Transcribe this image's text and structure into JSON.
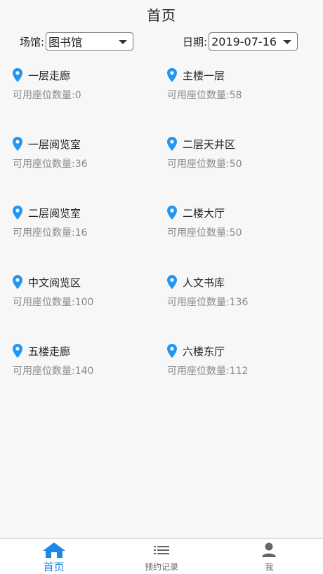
{
  "header": {
    "title": "首页"
  },
  "filters": {
    "venue_label": "场馆:",
    "venue_value": "图书馆",
    "date_label": "日期:",
    "date_value": "2019-07-16"
  },
  "areas": [
    {
      "name": "一层走廊",
      "count_label": "可用座位数量:0"
    },
    {
      "name": "主楼一层",
      "count_label": "可用座位数量:58"
    },
    {
      "name": "一层阅览室",
      "count_label": "可用座位数量:36"
    },
    {
      "name": "二层天井区",
      "count_label": "可用座位数量:50"
    },
    {
      "name": "二层阅览室",
      "count_label": "可用座位数量:16"
    },
    {
      "name": "二楼大厅",
      "count_label": "可用座位数量:50"
    },
    {
      "name": "中文阅览区",
      "count_label": "可用座位数量:100"
    },
    {
      "name": "人文书库",
      "count_label": "可用座位数量:136"
    },
    {
      "name": "五楼走廊",
      "count_label": "可用座位数量:140"
    },
    {
      "name": "六楼东厅",
      "count_label": "可用座位数量:112"
    }
  ],
  "tabbar": {
    "tabs": [
      {
        "label": "首页",
        "icon": "home-icon",
        "active": true
      },
      {
        "label": "预约记录",
        "icon": "list-icon",
        "active": false
      },
      {
        "label": "我",
        "icon": "user-icon",
        "active": false
      }
    ]
  },
  "colors": {
    "accent": "#1e88e5",
    "pin": "#2196f3",
    "muted_text": "#888888",
    "background": "#f7f7f7"
  }
}
